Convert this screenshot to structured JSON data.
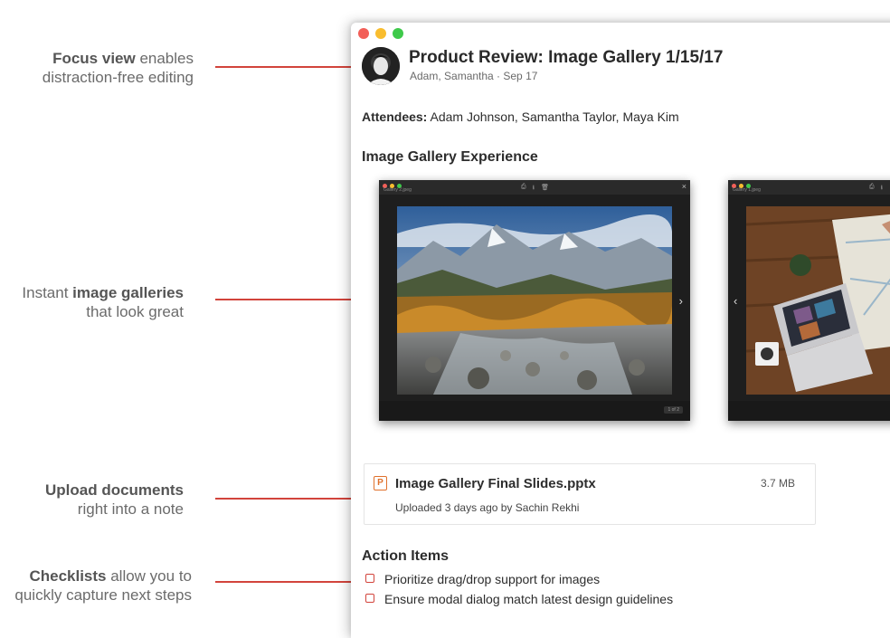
{
  "callouts": [
    {
      "bold": "Focus view",
      "rest": " enables",
      "line2": "distraction-free editing"
    },
    {
      "pre": "Instant ",
      "bold": "image galleries",
      "line2": "that look great"
    },
    {
      "bold": "Upload documents",
      "line2": "right into a note"
    },
    {
      "bold": "Checklists",
      "rest": " allow you to",
      "line2": "quickly capture next steps"
    }
  ],
  "note": {
    "title": "Product Review: Image Gallery 1/15/17",
    "subtitle": "Adam, Samantha · Sep 17",
    "attendees_label": "Attendees:",
    "attendees_value": " Adam Johnson, Samantha Taylor, Maya Kim",
    "gallery_heading": "Image Gallery Experience",
    "action_heading": "Action Items"
  },
  "gallery": [
    {
      "file": "Gallery 2.jpeg",
      "counter": "1 of 2",
      "next": "›"
    },
    {
      "file": "Gallery 1.jpeg",
      "prev": "‹"
    }
  ],
  "attachment": {
    "icon_letter": "P",
    "name": "Image Gallery Final Slides.pptx",
    "size": "3.7 MB",
    "meta": "Uploaded 3 days ago by Sachin Rekhi"
  },
  "action_items": [
    "Prioritize drag/drop support for images",
    "Ensure modal dialog match latest design guidelines"
  ],
  "colors": {
    "accent": "#d2443c",
    "ppt": "#e0712c"
  },
  "icons": [
    "print-icon",
    "download-icon",
    "trash-icon",
    "close-icon",
    "chevron-right-icon",
    "chevron-left-icon",
    "pptx-file-icon",
    "checkbox-icon"
  ]
}
